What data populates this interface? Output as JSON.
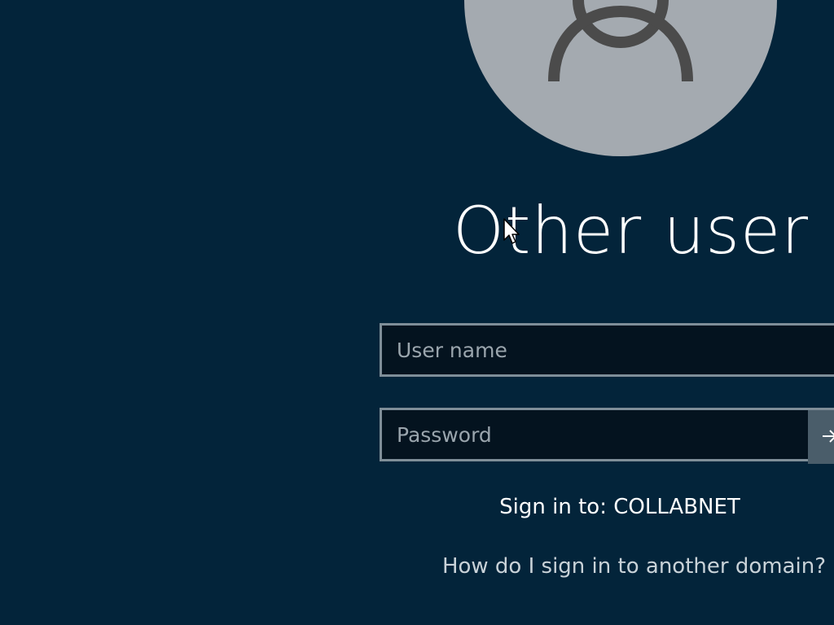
{
  "user_tile": {
    "title": "Other user",
    "avatar_icon": "user-silhouette-icon"
  },
  "username_field": {
    "value": "",
    "placeholder": "User name"
  },
  "password_field": {
    "value": "",
    "placeholder": "Password"
  },
  "submit": {
    "icon": "arrow-right-icon"
  },
  "signin": {
    "domain_text": "Sign in to: COLLABNET",
    "other_domain_link": "How do I sign in to another domain?"
  },
  "colors": {
    "background": "#03243a",
    "avatar_bg": "#a4aab0",
    "field_border": "#7f8e98",
    "field_bg": "#04131f"
  }
}
